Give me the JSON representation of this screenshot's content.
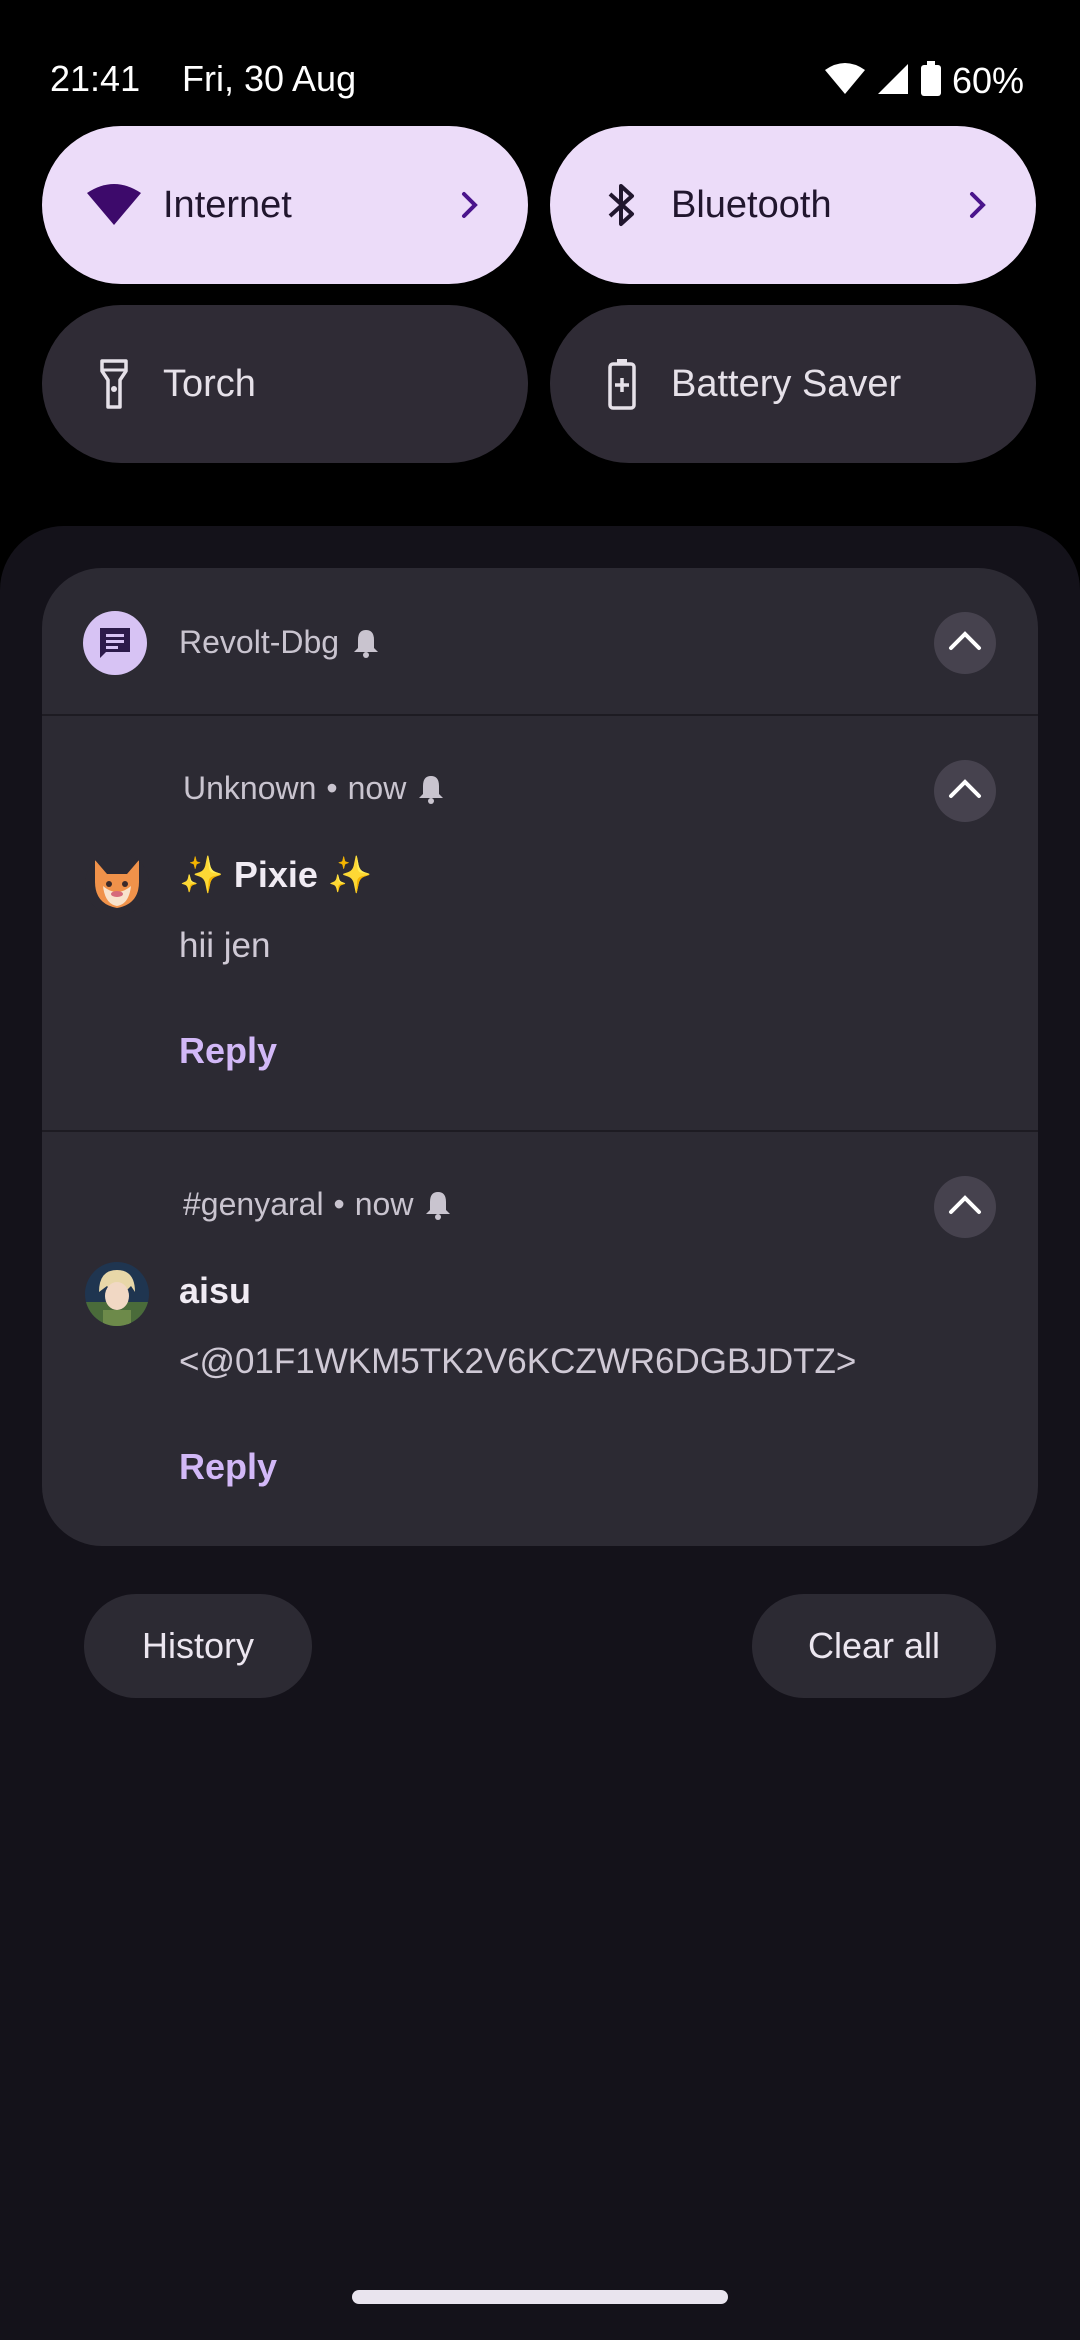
{
  "status_bar": {
    "time": "21:41",
    "date": "Fri, 30 Aug",
    "battery_percent": "60%"
  },
  "quick_settings": {
    "tiles": [
      {
        "label": "Internet",
        "icon": "wifi-icon",
        "state": "on",
        "has_chevron": true
      },
      {
        "label": "Bluetooth",
        "icon": "bluetooth-icon",
        "state": "on",
        "has_chevron": true
      },
      {
        "label": "Torch",
        "icon": "flashlight-icon",
        "state": "off",
        "has_chevron": false
      },
      {
        "label": "Battery Saver",
        "icon": "battery-saver-icon",
        "state": "off",
        "has_chevron": false
      }
    ]
  },
  "notification_group": {
    "app_name": "Revolt-Dbg",
    "app_icon": "message-icon",
    "notifications": [
      {
        "channel": "Unknown",
        "time": "now",
        "sender": "✨ Pixie ✨",
        "message": "hii jen",
        "reply_label": "Reply",
        "avatar": "fox-avatar"
      },
      {
        "channel": "#genyaral",
        "time": "now",
        "sender": "aisu",
        "message": "<@01F1WKM5TK2V6KCZWR6DGBJDTZ>",
        "reply_label": "Reply",
        "avatar": "anime-avatar"
      }
    ]
  },
  "footer": {
    "history_label": "History",
    "clear_all_label": "Clear all"
  },
  "colors": {
    "active_tile": "#ecdcf9",
    "inactive_tile": "#2f2b35",
    "accent": "#d2b8f7",
    "card": "#2c2a33",
    "shade": "#14121a"
  }
}
